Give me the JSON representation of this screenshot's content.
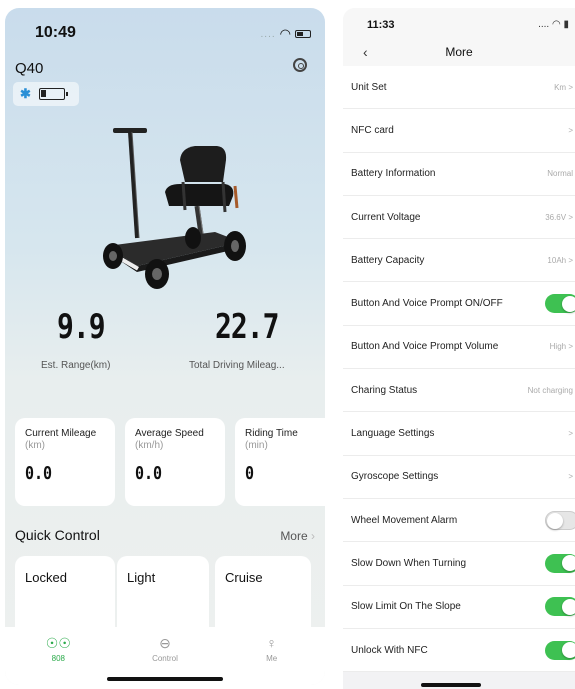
{
  "left": {
    "status_time": "10:49",
    "status_dots": "....",
    "model": "Q40",
    "stats": [
      {
        "value": "9.9",
        "label": "Est. Range(km)"
      },
      {
        "value": "22.7",
        "label": "Total Driving Mileag..."
      }
    ],
    "cards": [
      {
        "label": "Current Mileage",
        "unit": "(km)",
        "value": "0.0"
      },
      {
        "label": "Average Speed",
        "unit": "(km/h)",
        "value": "0.0"
      },
      {
        "label": "Riding Time",
        "unit": "(min)",
        "value": "0"
      }
    ],
    "quick_control": {
      "title": "Quick Control",
      "more": "More"
    },
    "controls": [
      "Locked",
      "Light",
      "Cruise"
    ],
    "tabs": [
      "808",
      "Control",
      "Me"
    ],
    "colors": {
      "accent": "#2aaa4a",
      "bluetooth": "#2a8fd6"
    }
  },
  "right": {
    "status_time": "11:33",
    "status_icons": "....",
    "title": "More",
    "items": [
      {
        "label": "Unit Set",
        "value": "Km >"
      },
      {
        "label": "NFC card",
        "value": ">"
      },
      {
        "label": "Battery Information",
        "value": "Normal"
      },
      {
        "label": "Current Voltage",
        "value": "36.6V >"
      },
      {
        "label": "Battery Capacity",
        "value": "10Ah >"
      },
      {
        "label": "Button And Voice Prompt ON/OFF",
        "toggle": "on"
      },
      {
        "label": "Button And Voice Prompt Volume",
        "value": "High >"
      },
      {
        "label": "Charing Status",
        "value": "Not charging"
      },
      {
        "label": "Language Settings",
        "value": ">"
      },
      {
        "label": "Gyroscope Settings",
        "value": ">"
      },
      {
        "label": "Wheel Movement Alarm",
        "toggle": "off"
      },
      {
        "label": "Slow Down When Turning",
        "toggle": "on"
      },
      {
        "label": "Slow Limit On The Slope",
        "toggle": "on"
      },
      {
        "label": "Unlock With NFC",
        "toggle": "on"
      }
    ],
    "colors": {
      "toggle_on": "#3ec152",
      "toggle_off": "#e6e6e6"
    }
  }
}
